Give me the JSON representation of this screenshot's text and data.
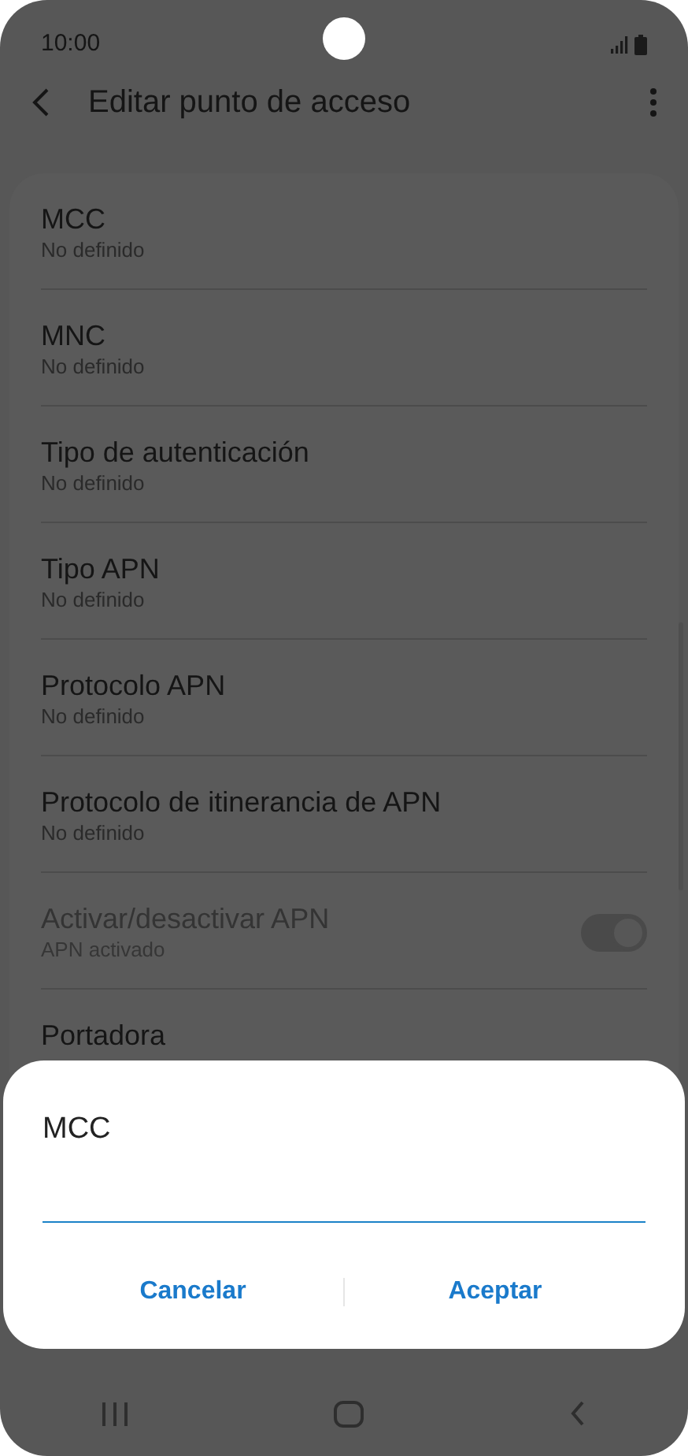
{
  "status_bar": {
    "time": "10:00"
  },
  "app_bar": {
    "title": "Editar punto de acceso"
  },
  "settings": [
    {
      "kind": "text",
      "title": "MCC",
      "summary": "No definido",
      "disabled": false
    },
    {
      "kind": "text",
      "title": "MNC",
      "summary": "No definido",
      "disabled": false
    },
    {
      "kind": "text",
      "title": "Tipo de autenticación",
      "summary": "No definido",
      "disabled": false
    },
    {
      "kind": "text",
      "title": "Tipo APN",
      "summary": "No definido",
      "disabled": false
    },
    {
      "kind": "text",
      "title": "Protocolo APN",
      "summary": "No definido",
      "disabled": false
    },
    {
      "kind": "text",
      "title": "Protocolo de itinerancia de APN",
      "summary": "No definido",
      "disabled": false
    },
    {
      "kind": "toggle",
      "title": "Activar/desactivar APN",
      "summary": "APN activado",
      "disabled": true,
      "on": true
    },
    {
      "kind": "text",
      "title": "Portadora",
      "disabled": false
    }
  ],
  "dialog": {
    "title": "MCC",
    "buttons": [
      "Cancelar",
      "Aceptar"
    ]
  }
}
